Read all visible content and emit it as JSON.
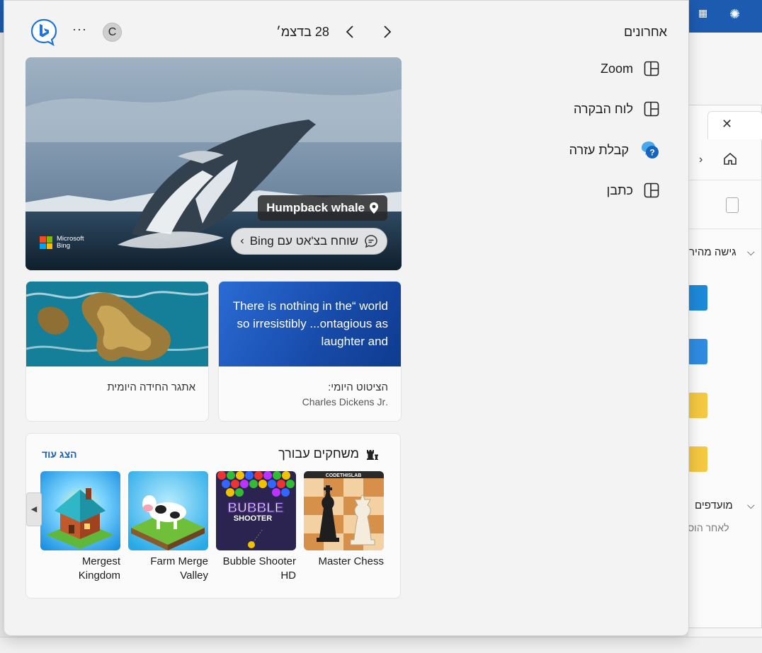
{
  "header": {
    "temperature": "28 בדצמ׳",
    "avatar_letter": "C",
    "more_label": "···"
  },
  "recent": {
    "title": "אחרונים",
    "items": [
      {
        "label": "Zoom",
        "icon": "widget-board-icon"
      },
      {
        "label": "לוח הבקרה",
        "icon": "widget-board-icon"
      },
      {
        "label": "קבלת עזרה",
        "icon": "get-help-icon"
      },
      {
        "label": "כתבן",
        "icon": "widget-board-icon"
      }
    ]
  },
  "hero": {
    "badge": "Humpback whale",
    "chat_label": "שוחח בצ'אט עם Bing",
    "brand_line1": "Microsoft",
    "brand_line2": "Bing"
  },
  "quote_card": {
    "quote": "There is nothing in the“ world so irresistibly ...ontagious as laughter and",
    "title": "הציטוט היומי:",
    "author": ".Charles Dickens Jr"
  },
  "puzzle_card": {
    "title": "אתגר החידה היומית"
  },
  "games": {
    "title": "משחקים עבורך",
    "show_more": "הצג עוד",
    "items": [
      {
        "name": "Master Chess"
      },
      {
        "name": "Bubble Shooter HD"
      },
      {
        "name": "Farm Merge Valley"
      },
      {
        "name": "Mergest Kingdom"
      }
    ],
    "bubble_logo_line1": "BUBBLE",
    "bubble_logo_line2": "SHOOTER",
    "chess_logo": "CODETHISLAB"
  },
  "explorer": {
    "section_quick": "גישה מהיר",
    "section_fav": "מועדפים",
    "section_fav_sub": "לאחר הוס"
  },
  "colors": {
    "panel_bg": "#f3f3f3",
    "accent": "#1a5fb4",
    "taskbar_blue": "#1c5bb0"
  }
}
